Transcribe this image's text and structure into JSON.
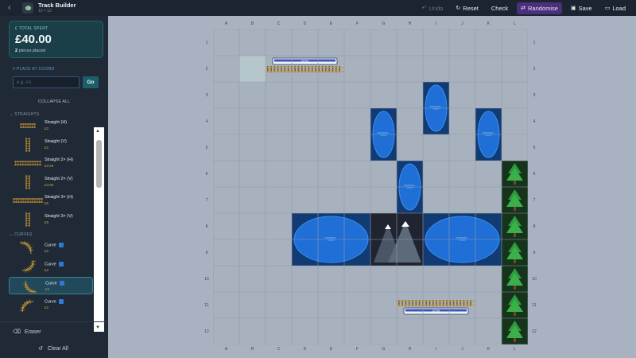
{
  "header": {
    "title": "Track Builder",
    "subtitle": "12 × 12",
    "actions": {
      "undo": "Undo",
      "reset": "Reset",
      "check": "Check",
      "randomise": "Randomise",
      "save": "Save",
      "load": "Load"
    }
  },
  "sidebar": {
    "total_spent_label": "TOTAL SPENT",
    "total_spent_value": "£40.00",
    "pieces_count": "2",
    "pieces_suffix": "pieces placed",
    "place_label": "PLACE AT COORD",
    "coord_placeholder": "e.g. A1",
    "go_label": "Go",
    "collapse_label": "COLLAPSE ALL",
    "straights_label": "STRAIGHTS",
    "curves_label": "CURVES",
    "pieces": [
      {
        "name": "Straight (H)",
        "price": "£2",
        "thumb": "h1"
      },
      {
        "name": "Straight (V)",
        "price": "£2",
        "thumb": "v1"
      },
      {
        "name": "Straight 2× (H)",
        "price": "£3.50",
        "thumb": "h2"
      },
      {
        "name": "Straight 2× (V)",
        "price": "£3.50",
        "thumb": "v2"
      },
      {
        "name": "Straight 3× (H)",
        "price": "£5",
        "thumb": "h3"
      },
      {
        "name": "Straight 3× (V)",
        "price": "£5",
        "thumb": "v3"
      }
    ],
    "curves": [
      {
        "name": "Curve",
        "price": "£2",
        "thumb": "c1"
      },
      {
        "name": "Curve",
        "price": "£2",
        "thumb": "c2"
      },
      {
        "name": "Curve",
        "price": "£2",
        "thumb": "c3",
        "selected": true
      },
      {
        "name": "Curve",
        "price": "£2",
        "thumb": "c4"
      }
    ],
    "eraser_label": "Eraser",
    "clear_label": "Clear All"
  },
  "board": {
    "columns": [
      "A",
      "B",
      "C",
      "D",
      "E",
      "F",
      "G",
      "H",
      "I",
      "J",
      "K",
      "L"
    ],
    "rows": [
      "1",
      "2",
      "3",
      "4",
      "5",
      "6",
      "7",
      "8",
      "9",
      "10",
      "11",
      "12"
    ],
    "highlight_cell": "B2",
    "lakes": [
      {
        "cells": [
          "I3",
          "I4"
        ],
        "shape": "small"
      },
      {
        "cells": [
          "G4",
          "G5"
        ],
        "shape": "small"
      },
      {
        "cells": [
          "K4",
          "K5"
        ],
        "shape": "small"
      },
      {
        "cells": [
          "H6",
          "H7"
        ],
        "shape": "small"
      },
      {
        "cells": [
          "D8",
          "F9"
        ],
        "shape": "wide"
      },
      {
        "cells": [
          "I8",
          "K9"
        ],
        "shape": "wide"
      }
    ],
    "mountain": {
      "cells": [
        "G8",
        "H9"
      ]
    },
    "trees_column": "L",
    "trees_rows": [
      6,
      12
    ],
    "placed": [
      {
        "piece": "Straight 3× (H)",
        "at": "C2",
        "train": "top",
        "train_label": "ST/PM"
      },
      {
        "piece": "Straight 3× (H)",
        "at": "H11",
        "train": "bottom",
        "train_label": "ST/PM"
      }
    ]
  },
  "colors": {
    "accent": "#4b2f7a",
    "water": "#1f6fd6",
    "water_bg": "#133b73",
    "tree": "#2e9a3c",
    "track": "#c49a3c"
  }
}
